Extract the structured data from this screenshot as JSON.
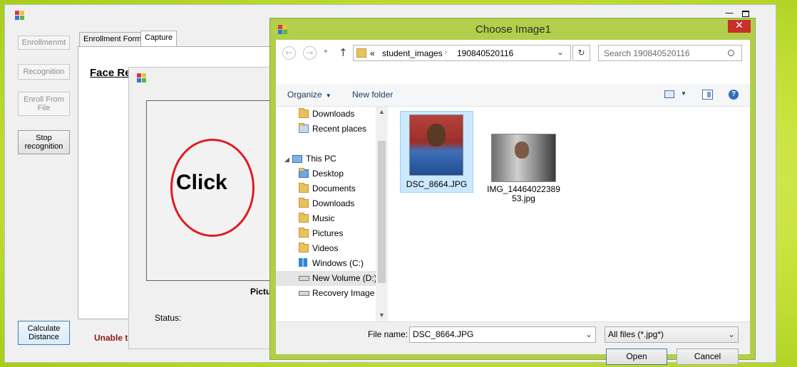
{
  "main_window": {
    "side_buttons": {
      "enrollment": "Enrollmenmt",
      "recognition": "Recognition",
      "enroll_from_file": "Enroll From File",
      "stop_recognition": "Stop recognition",
      "calculate_distance": "Calculate Distance"
    },
    "tabs": [
      "Enrollment Form",
      "Capture"
    ],
    "heading": "Face Re",
    "error_text": "Unable to"
  },
  "capture_window": {
    "annotation": "Click",
    "picture_label": "Pictu",
    "status_label": "Status:"
  },
  "dialog": {
    "title": "Choose Image1",
    "close": "✕",
    "address": {
      "prefix": "«",
      "crumbs": [
        "student_images",
        "190840520116"
      ]
    },
    "search_placeholder": "Search 190840520116",
    "toolbar": {
      "organize": "Organize",
      "new_folder": "New folder"
    },
    "tree": {
      "favorites": [
        "Downloads",
        "Recent places"
      ],
      "this_pc": "This PC",
      "pc_items": [
        "Desktop",
        "Documents",
        "Downloads",
        "Music",
        "Pictures",
        "Videos",
        "Windows (C:)",
        "New Volume (D:)",
        "Recovery Image ("
      ]
    },
    "files": [
      {
        "name": "DSC_8664.JPG",
        "name2": ""
      },
      {
        "name": "IMG_14464022389",
        "name2": "53.jpg"
      }
    ],
    "file_name_label": "File name:",
    "file_name_value": "DSC_8664.JPG",
    "filter_value": "All files (*.jpg*)",
    "open_button": "Open",
    "cancel_button": "Cancel"
  },
  "colors": {
    "desktop_bg": "#c7e23a",
    "dialog_frame": "#b1cf4a",
    "close_red": "#c7302b",
    "selection_blue": "#cce8ff",
    "error_red": "#8b1a1a",
    "annotation_red": "#e01b24"
  }
}
